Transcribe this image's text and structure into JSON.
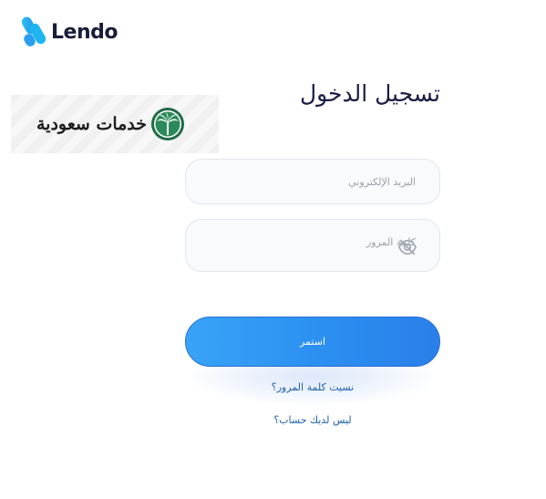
{
  "brand": {
    "name": "Lendo",
    "logo_icon": "lendo-logo-icon",
    "accent_color": "#1fb6f0"
  },
  "service_badge": {
    "text": "خدمات سعودية",
    "emblem_icon": "palm-emblem-icon"
  },
  "login": {
    "title": "تسجيل الدخول",
    "email_placeholder": "البريد الإلكتروني",
    "email_value": "",
    "password_placeholder": "كلمة المرور",
    "password_value": "",
    "password_toggle_icon": "eye-slash-icon",
    "submit_label": "استمر",
    "forgot_password_link": "نسيت كلمة المرور؟",
    "no_account_link": "ليس لديك حساب؟"
  },
  "colors": {
    "button_start": "#38a3f7",
    "button_end": "#2a7fe9",
    "title": "#1a1d45",
    "link": "#1d5fae"
  }
}
